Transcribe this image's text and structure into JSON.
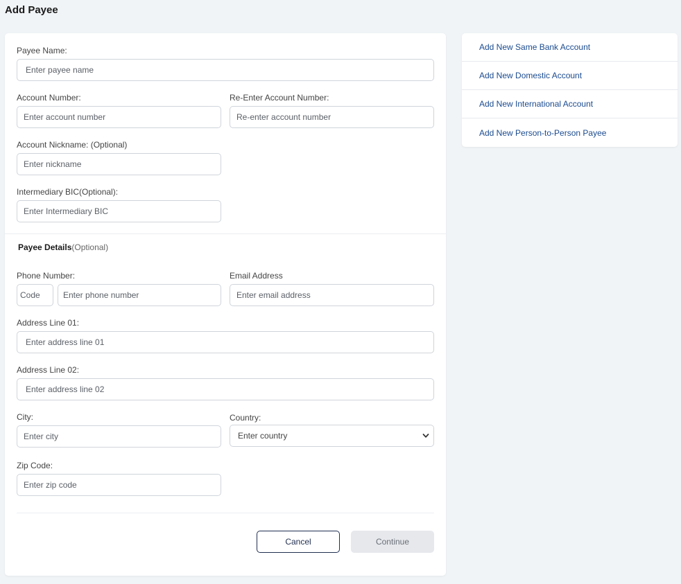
{
  "page": {
    "title": "Add Payee"
  },
  "form": {
    "payee_name": {
      "label": "Payee Name:",
      "placeholder": "Enter payee name"
    },
    "account_number": {
      "label": "Account Number:",
      "placeholder": "Enter account number"
    },
    "reenter_account": {
      "label": "Re-Enter Account Number:",
      "placeholder": "Re-enter account number"
    },
    "nickname": {
      "label": "Account Nickname: (Optional)",
      "placeholder": "Enter nickname"
    },
    "intermediary_bic": {
      "label": "Intermediary BIC(Optional):",
      "placeholder": "Enter Intermediary BIC"
    },
    "payee_details": {
      "title": "Payee Details",
      "optional": "(Optional)"
    },
    "phone": {
      "label": "Phone Number:",
      "code_placeholder": "Code",
      "placeholder": "Enter phone number"
    },
    "email": {
      "label": "Email Address",
      "placeholder": "Enter email address"
    },
    "address1": {
      "label": "Address Line 01:",
      "placeholder": "Enter address line 01"
    },
    "address2": {
      "label": "Address Line 02:",
      "placeholder": "Enter address line 02"
    },
    "city": {
      "label": "City:",
      "placeholder": "Enter city"
    },
    "country": {
      "label": "Country:",
      "selected": "Enter country"
    },
    "zip": {
      "label": "Zip Code:",
      "placeholder": "Enter zip code"
    },
    "cancel_label": "Cancel",
    "continue_label": "Continue"
  },
  "sidebar": {
    "links": [
      "Add New Same Bank Account",
      "Add New Domestic Account",
      "Add New International Account",
      "Add New Person-to-Person Payee"
    ]
  },
  "colors": {
    "background": "#f1f4f7",
    "link": "#1b4b8f",
    "cancel_border": "#1f2d4f",
    "continue_bg": "#e6e8ec"
  },
  "icons": {
    "country_select": "chevron-down-icon"
  }
}
